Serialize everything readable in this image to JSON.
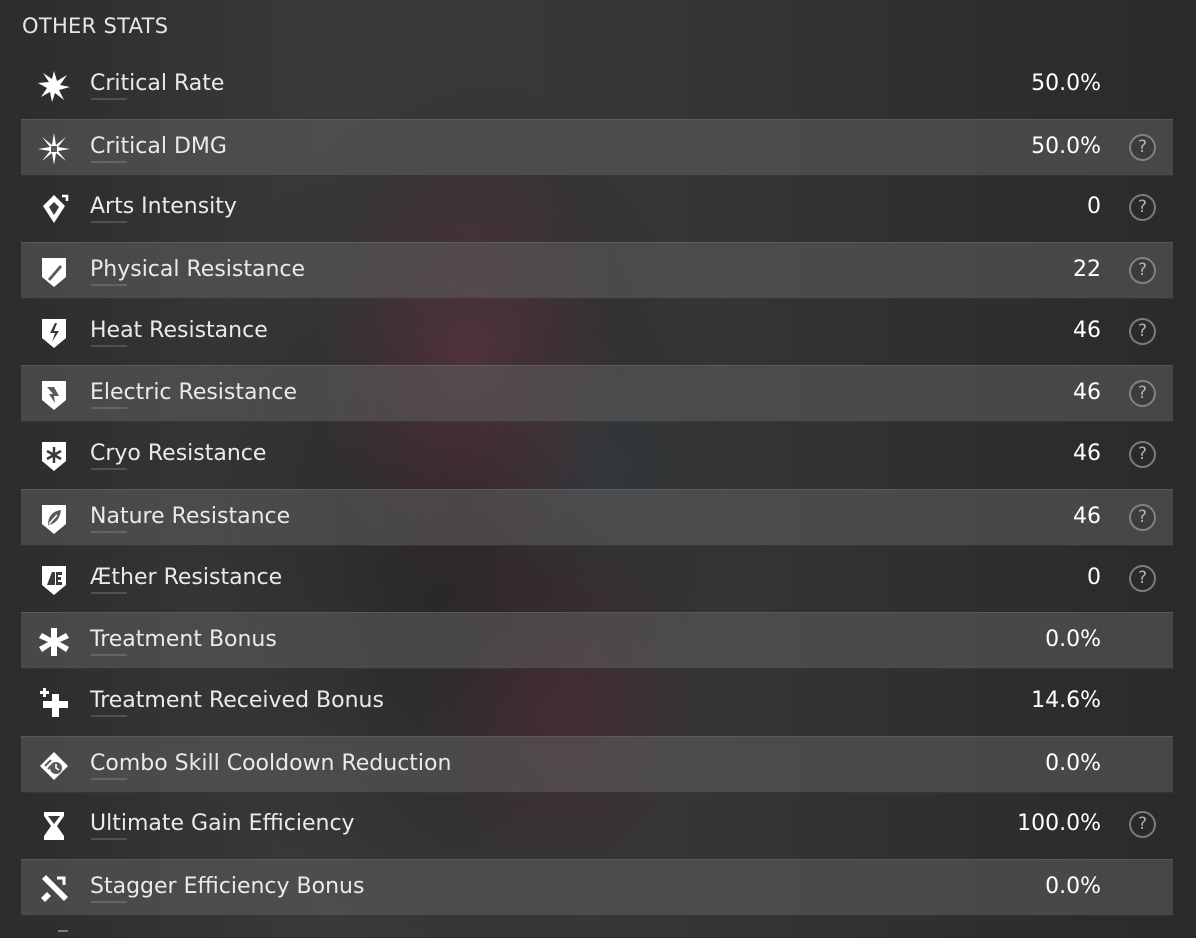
{
  "section_title": "OTHER STATS",
  "help_glyph": "?",
  "stats": [
    {
      "icon": "critical-rate-icon",
      "label": "Critical Rate",
      "value": "50.0%",
      "help": false
    },
    {
      "icon": "critical-dmg-icon",
      "label": "Critical DMG",
      "value": "50.0%",
      "help": true
    },
    {
      "icon": "arts-intensity-icon",
      "label": "Arts Intensity",
      "value": "0",
      "help": true
    },
    {
      "icon": "physical-resistance-icon",
      "label": "Physical Resistance",
      "value": "22",
      "help": true
    },
    {
      "icon": "heat-resistance-icon",
      "label": "Heat Resistance",
      "value": "46",
      "help": true
    },
    {
      "icon": "electric-resistance-icon",
      "label": "Electric Resistance",
      "value": "46",
      "help": true
    },
    {
      "icon": "cryo-resistance-icon",
      "label": "Cryo Resistance",
      "value": "46",
      "help": true
    },
    {
      "icon": "nature-resistance-icon",
      "label": "Nature Resistance",
      "value": "46",
      "help": true
    },
    {
      "icon": "aether-resistance-icon",
      "label": "Æther Resistance",
      "value": "0",
      "help": true
    },
    {
      "icon": "treatment-bonus-icon",
      "label": "Treatment Bonus",
      "value": "0.0%",
      "help": false
    },
    {
      "icon": "treatment-received-bonus-icon",
      "label": "Treatment Received Bonus",
      "value": "14.6%",
      "help": false
    },
    {
      "icon": "combo-skill-cooldown-icon",
      "label": "Combo Skill Cooldown Reduction",
      "value": "0.0%",
      "help": false
    },
    {
      "icon": "hourglass-icon",
      "label": "Ultimate Gain Efficiency",
      "value": "100.0%",
      "help": true
    },
    {
      "icon": "stagger-efficiency-icon",
      "label": "Stagger Efficiency Bonus",
      "value": "0.0%",
      "help": false
    }
  ]
}
